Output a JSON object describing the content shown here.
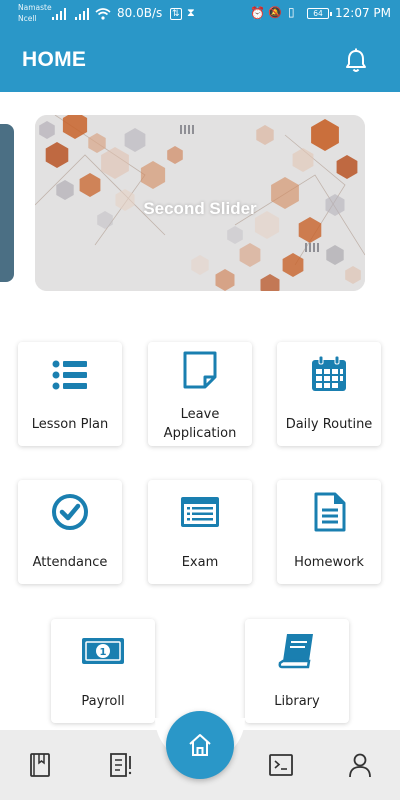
{
  "status_bar": {
    "carrier_line1": "Namaste",
    "carrier_line2": "Ncell",
    "net_speed": "80.0B/s",
    "battery": "64",
    "time": "12:07 PM"
  },
  "app_bar": {
    "title": "HOME",
    "notification_icon": "bell-icon"
  },
  "slider": {
    "caption": "Second Slider"
  },
  "menu": {
    "items": [
      {
        "label": "Lesson Plan",
        "icon": "list-icon"
      },
      {
        "label_line1": "Leave",
        "label_line2": "Application",
        "icon": "note-icon"
      },
      {
        "label": "Daily Routine",
        "icon": "calendar-icon"
      },
      {
        "label": "Attendance",
        "icon": "check-circle-icon"
      },
      {
        "label": "Exam",
        "icon": "exam-window-icon"
      },
      {
        "label": "Homework",
        "icon": "document-icon"
      },
      {
        "label": "Payroll",
        "icon": "money-icon"
      },
      {
        "label": "Library",
        "icon": "book-icon"
      }
    ]
  },
  "bottom_nav": {
    "items": [
      "book-icon",
      "report-icon",
      "home-icon",
      "terminal-icon",
      "user-icon"
    ]
  },
  "colors": {
    "primary": "#2a97c8",
    "icon": "#1a7fb0",
    "slider_accent": "#c8632a"
  }
}
